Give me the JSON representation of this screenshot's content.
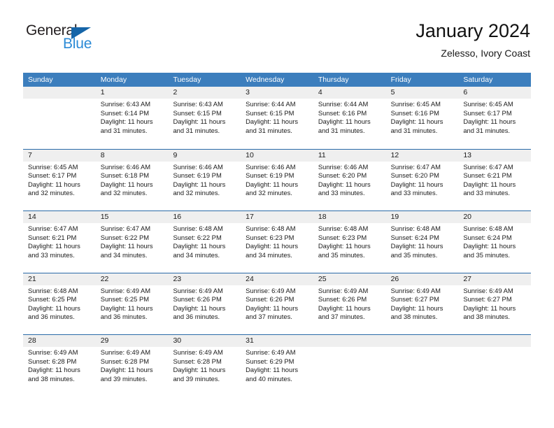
{
  "brand": {
    "name_top": "General",
    "name_bottom": "Blue",
    "triangle_color": "#1565a8",
    "blue_color": "#2b8ad6"
  },
  "header": {
    "title": "January 2024",
    "subtitle": "Zelesso, Ivory Coast"
  },
  "theme": {
    "header_bg": "#3c7ebd",
    "row_divider": "#2a6aa8",
    "daynum_bg": "#efefef"
  },
  "weekdays": [
    "Sunday",
    "Monday",
    "Tuesday",
    "Wednesday",
    "Thursday",
    "Friday",
    "Saturday"
  ],
  "weeks": [
    [
      {
        "day": "",
        "lines": []
      },
      {
        "day": "1",
        "lines": [
          "Sunrise: 6:43 AM",
          "Sunset: 6:14 PM",
          "Daylight: 11 hours",
          "and 31 minutes."
        ]
      },
      {
        "day": "2",
        "lines": [
          "Sunrise: 6:43 AM",
          "Sunset: 6:15 PM",
          "Daylight: 11 hours",
          "and 31 minutes."
        ]
      },
      {
        "day": "3",
        "lines": [
          "Sunrise: 6:44 AM",
          "Sunset: 6:15 PM",
          "Daylight: 11 hours",
          "and 31 minutes."
        ]
      },
      {
        "day": "4",
        "lines": [
          "Sunrise: 6:44 AM",
          "Sunset: 6:16 PM",
          "Daylight: 11 hours",
          "and 31 minutes."
        ]
      },
      {
        "day": "5",
        "lines": [
          "Sunrise: 6:45 AM",
          "Sunset: 6:16 PM",
          "Daylight: 11 hours",
          "and 31 minutes."
        ]
      },
      {
        "day": "6",
        "lines": [
          "Sunrise: 6:45 AM",
          "Sunset: 6:17 PM",
          "Daylight: 11 hours",
          "and 31 minutes."
        ]
      }
    ],
    [
      {
        "day": "7",
        "lines": [
          "Sunrise: 6:45 AM",
          "Sunset: 6:17 PM",
          "Daylight: 11 hours",
          "and 32 minutes."
        ]
      },
      {
        "day": "8",
        "lines": [
          "Sunrise: 6:46 AM",
          "Sunset: 6:18 PM",
          "Daylight: 11 hours",
          "and 32 minutes."
        ]
      },
      {
        "day": "9",
        "lines": [
          "Sunrise: 6:46 AM",
          "Sunset: 6:19 PM",
          "Daylight: 11 hours",
          "and 32 minutes."
        ]
      },
      {
        "day": "10",
        "lines": [
          "Sunrise: 6:46 AM",
          "Sunset: 6:19 PM",
          "Daylight: 11 hours",
          "and 32 minutes."
        ]
      },
      {
        "day": "11",
        "lines": [
          "Sunrise: 6:46 AM",
          "Sunset: 6:20 PM",
          "Daylight: 11 hours",
          "and 33 minutes."
        ]
      },
      {
        "day": "12",
        "lines": [
          "Sunrise: 6:47 AM",
          "Sunset: 6:20 PM",
          "Daylight: 11 hours",
          "and 33 minutes."
        ]
      },
      {
        "day": "13",
        "lines": [
          "Sunrise: 6:47 AM",
          "Sunset: 6:21 PM",
          "Daylight: 11 hours",
          "and 33 minutes."
        ]
      }
    ],
    [
      {
        "day": "14",
        "lines": [
          "Sunrise: 6:47 AM",
          "Sunset: 6:21 PM",
          "Daylight: 11 hours",
          "and 33 minutes."
        ]
      },
      {
        "day": "15",
        "lines": [
          "Sunrise: 6:47 AM",
          "Sunset: 6:22 PM",
          "Daylight: 11 hours",
          "and 34 minutes."
        ]
      },
      {
        "day": "16",
        "lines": [
          "Sunrise: 6:48 AM",
          "Sunset: 6:22 PM",
          "Daylight: 11 hours",
          "and 34 minutes."
        ]
      },
      {
        "day": "17",
        "lines": [
          "Sunrise: 6:48 AM",
          "Sunset: 6:23 PM",
          "Daylight: 11 hours",
          "and 34 minutes."
        ]
      },
      {
        "day": "18",
        "lines": [
          "Sunrise: 6:48 AM",
          "Sunset: 6:23 PM",
          "Daylight: 11 hours",
          "and 35 minutes."
        ]
      },
      {
        "day": "19",
        "lines": [
          "Sunrise: 6:48 AM",
          "Sunset: 6:24 PM",
          "Daylight: 11 hours",
          "and 35 minutes."
        ]
      },
      {
        "day": "20",
        "lines": [
          "Sunrise: 6:48 AM",
          "Sunset: 6:24 PM",
          "Daylight: 11 hours",
          "and 35 minutes."
        ]
      }
    ],
    [
      {
        "day": "21",
        "lines": [
          "Sunrise: 6:48 AM",
          "Sunset: 6:25 PM",
          "Daylight: 11 hours",
          "and 36 minutes."
        ]
      },
      {
        "day": "22",
        "lines": [
          "Sunrise: 6:49 AM",
          "Sunset: 6:25 PM",
          "Daylight: 11 hours",
          "and 36 minutes."
        ]
      },
      {
        "day": "23",
        "lines": [
          "Sunrise: 6:49 AM",
          "Sunset: 6:26 PM",
          "Daylight: 11 hours",
          "and 36 minutes."
        ]
      },
      {
        "day": "24",
        "lines": [
          "Sunrise: 6:49 AM",
          "Sunset: 6:26 PM",
          "Daylight: 11 hours",
          "and 37 minutes."
        ]
      },
      {
        "day": "25",
        "lines": [
          "Sunrise: 6:49 AM",
          "Sunset: 6:26 PM",
          "Daylight: 11 hours",
          "and 37 minutes."
        ]
      },
      {
        "day": "26",
        "lines": [
          "Sunrise: 6:49 AM",
          "Sunset: 6:27 PM",
          "Daylight: 11 hours",
          "and 38 minutes."
        ]
      },
      {
        "day": "27",
        "lines": [
          "Sunrise: 6:49 AM",
          "Sunset: 6:27 PM",
          "Daylight: 11 hours",
          "and 38 minutes."
        ]
      }
    ],
    [
      {
        "day": "28",
        "lines": [
          "Sunrise: 6:49 AM",
          "Sunset: 6:28 PM",
          "Daylight: 11 hours",
          "and 38 minutes."
        ]
      },
      {
        "day": "29",
        "lines": [
          "Sunrise: 6:49 AM",
          "Sunset: 6:28 PM",
          "Daylight: 11 hours",
          "and 39 minutes."
        ]
      },
      {
        "day": "30",
        "lines": [
          "Sunrise: 6:49 AM",
          "Sunset: 6:28 PM",
          "Daylight: 11 hours",
          "and 39 minutes."
        ]
      },
      {
        "day": "31",
        "lines": [
          "Sunrise: 6:49 AM",
          "Sunset: 6:29 PM",
          "Daylight: 11 hours",
          "and 40 minutes."
        ]
      },
      {
        "day": "",
        "lines": []
      },
      {
        "day": "",
        "lines": []
      },
      {
        "day": "",
        "lines": []
      }
    ]
  ]
}
